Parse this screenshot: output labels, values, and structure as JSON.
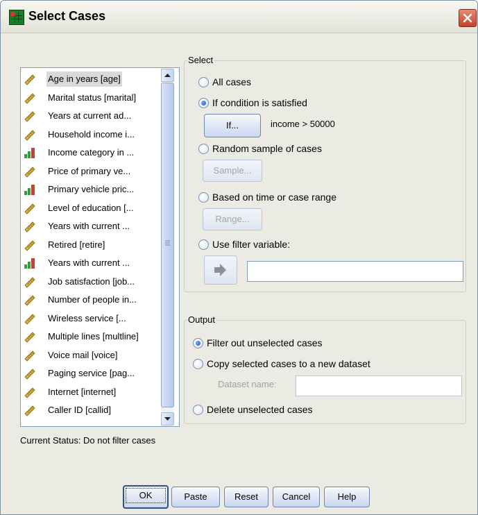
{
  "window": {
    "title": "Select Cases"
  },
  "variables": [
    {
      "label": "Age in years [age]",
      "icon": "scale-ruler-icon",
      "selected": true
    },
    {
      "label": "Marital status [marital]",
      "icon": "scale-ruler-icon"
    },
    {
      "label": "Years at current ad...",
      "icon": "scale-ruler-icon"
    },
    {
      "label": "Household income i...",
      "icon": "scale-ruler-icon"
    },
    {
      "label": "Income category in ...",
      "icon": "ordinal-bars-icon"
    },
    {
      "label": "Price of primary ve...",
      "icon": "scale-ruler-icon"
    },
    {
      "label": "Primary vehicle pric...",
      "icon": "ordinal-bars-icon"
    },
    {
      "label": "Level of education [...",
      "icon": "scale-ruler-icon"
    },
    {
      "label": "Years with current ...",
      "icon": "scale-ruler-icon"
    },
    {
      "label": "Retired [retire]",
      "icon": "scale-ruler-icon"
    },
    {
      "label": "Years with current ...",
      "icon": "ordinal-bars-icon"
    },
    {
      "label": "Job satisfaction [job...",
      "icon": "scale-ruler-icon"
    },
    {
      "label": "Number of people in...",
      "icon": "scale-ruler-icon"
    },
    {
      "label": "Wireless service [...",
      "icon": "scale-ruler-icon"
    },
    {
      "label": "Multiple lines [multline]",
      "icon": "scale-ruler-icon"
    },
    {
      "label": "Voice mail [voice]",
      "icon": "scale-ruler-icon"
    },
    {
      "label": "Paging service [pag...",
      "icon": "scale-ruler-icon"
    },
    {
      "label": "Internet [internet]",
      "icon": "scale-ruler-icon"
    },
    {
      "label": "Caller ID [callid]",
      "icon": "scale-ruler-icon"
    }
  ],
  "select": {
    "legend": "Select",
    "all_cases": "All cases",
    "if_condition": "If condition is satisfied",
    "if_button": "If...",
    "condition_text": "income > 50000",
    "random_sample": "Random sample of cases",
    "sample_button": "Sample...",
    "time_range": "Based on time or case range",
    "range_button": "Range...",
    "filter_variable": "Use filter variable:",
    "filter_value": ""
  },
  "output": {
    "legend": "Output",
    "filter_out": "Filter out unselected cases",
    "copy_cases": "Copy selected cases to a new dataset",
    "dataset_label": "Dataset name:",
    "dataset_value": "",
    "delete_cases": "Delete unselected cases"
  },
  "status": "Current Status: Do not filter cases",
  "buttons": {
    "ok": "OK",
    "paste": "Paste",
    "reset": "Reset",
    "cancel": "Cancel",
    "help": "Help"
  },
  "colors": {
    "scale_icon": "#d6b43a",
    "ordinal_green": "#3b9a3b",
    "ordinal_red": "#d43b2b",
    "accent": "#2d4f8a"
  }
}
